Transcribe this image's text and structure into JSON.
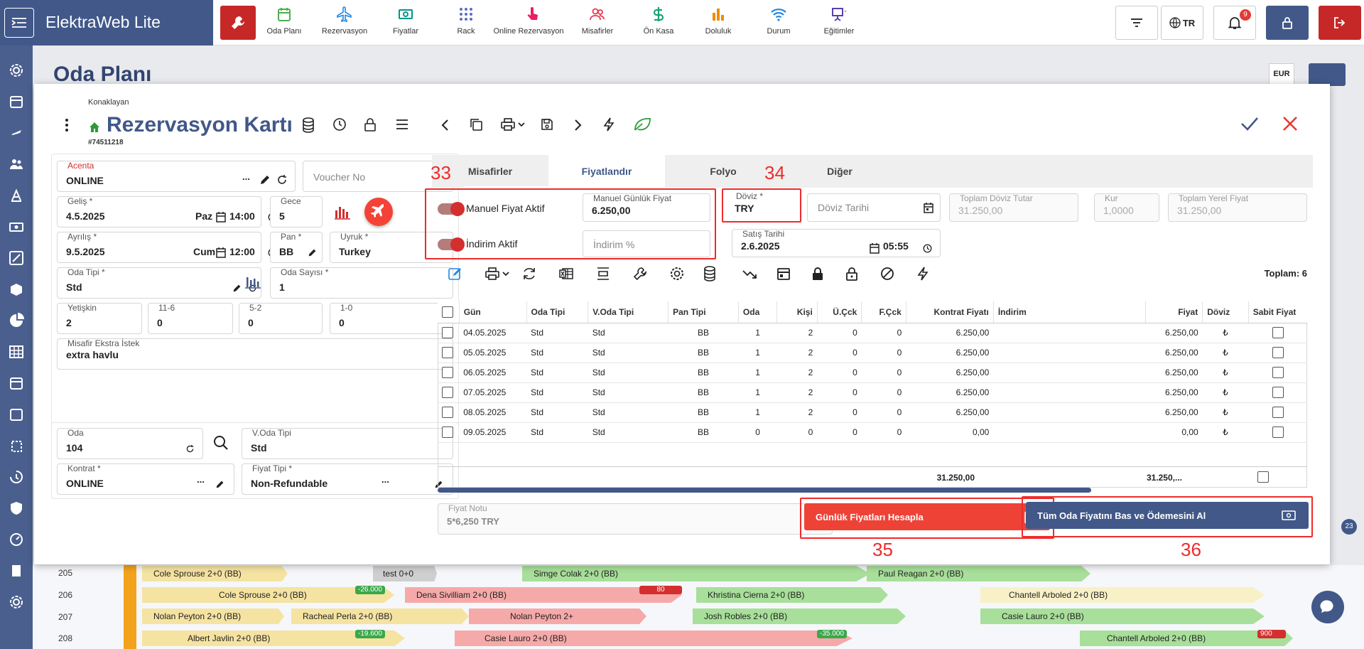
{
  "app": {
    "title": "ElektraWeb Lite"
  },
  "nav": [
    {
      "label": "Oda Planı",
      "icon": "calendar-icon"
    },
    {
      "label": "Rezervasyon",
      "icon": "plane-icon"
    },
    {
      "label": "Fiyatlar",
      "icon": "money-icon"
    },
    {
      "label": "Rack",
      "icon": "grid-dots-icon"
    },
    {
      "label": "Online Rezervasyon",
      "icon": "touch-icon"
    },
    {
      "label": "Misafirler",
      "icon": "users-icon"
    },
    {
      "label": "Ön Kasa",
      "icon": "dollar-icon"
    },
    {
      "label": "Doluluk",
      "icon": "bar-chart-icon"
    },
    {
      "label": "Durum",
      "icon": "wifi-icon"
    },
    {
      "label": "Eğitimler",
      "icon": "presentation-icon"
    }
  ],
  "topbar": {
    "language": "TR",
    "notifications": "9"
  },
  "background": {
    "page_title": "Oda Planı",
    "currency": "EUR",
    "rooms": [
      {
        "no": "205",
        "bookings": [
          "Cole Sprouse 2+0 (BB)",
          "test 0+0",
          "Simge Colak 2+0 (BB)",
          "Paul Reagan 2+0 (BB)"
        ]
      },
      {
        "no": "206",
        "bookings": [
          "Cole Sprouse 2+0 (BB)",
          "Dena Sivilliam 2+0 (BB)",
          "Khristina Cierna 2+0 (BB)",
          "Chantell Arboled 2+0 (BB)"
        ],
        "tags": [
          "-26.000",
          "80"
        ]
      },
      {
        "no": "207",
        "bookings": [
          "Nolan Peyton 2+0 (BB)",
          "Racheal Perla 2+0 (BB)",
          "Nolan Peyton 2+",
          "Josh Robles 2+0 (BB)",
          "Casie Lauro 2+0 (BB)"
        ]
      },
      {
        "no": "208",
        "bookings": [
          "Albert Javlin 2+0 (BB)",
          "Casie Lauro 2+0 (BB)",
          "Chantell Arboled 2+0 (BB)"
        ],
        "tags": [
          "-19.600",
          "-35.000",
          "900"
        ]
      }
    ],
    "side_badge": "23"
  },
  "modal": {
    "subtitle": "Konaklayan",
    "title": "Rezervasyon Kartı",
    "res_no": "#74511218",
    "tabs": [
      "Misafirler",
      "Fiyatlandır",
      "Folyo",
      "Diğer"
    ],
    "left": {
      "acenta_label": "Acenta",
      "acenta_value": "ONLINE",
      "voucher_placeholder": "Voucher No",
      "gelis_label": "Geliş *",
      "gelis_date": "4.5.2025",
      "gelis_day": "Paz",
      "gelis_time": "14:00",
      "gece_label": "Gece",
      "gece_value": "5",
      "ayrilis_label": "Ayrılış *",
      "ayrilis_date": "9.5.2025",
      "ayrilis_day": "Cum",
      "ayrilis_time": "12:00",
      "pan_label": "Pan *",
      "pan_value": "BB",
      "uyruk_label": "Uyruk *",
      "uyruk_value": "Turkey",
      "odatipi_label": "Oda Tipi *",
      "odatipi_value": "Std",
      "odasayisi_label": "Oda Sayısı *",
      "odasayisi_value": "1",
      "yetiskin_label": "Yetişkin",
      "yetiskin_value": "2",
      "c1_label": "11-6",
      "c1_value": "0",
      "c2_label": "5-2",
      "c2_value": "0",
      "c3_label": "1-0",
      "c3_value": "0",
      "ekstra_label": "Misafir Ekstra İstek",
      "ekstra_value": "extra havlu",
      "oda_label": "Oda",
      "oda_value": "104",
      "voda_label": "V.Oda Tipi",
      "voda_value": "Std",
      "kontrat_label": "Kontrat *",
      "kontrat_value": "ONLINE",
      "fiyattipi_label": "Fiyat Tipi *",
      "fiyattipi_value": "Non-Refundable"
    },
    "pricing": {
      "manuel_fiyat_label": "Manuel Fiyat Aktif",
      "indirim_aktif_label": "İndirim Aktif",
      "manuel_gunluk_label": "Manuel Günlük Fiyat",
      "manuel_gunluk_value": "6.250,00",
      "indirim_placeholder": "İndirim %",
      "doviz_label": "Döviz *",
      "doviz_value": "TRY",
      "doviz_tarihi_placeholder": "Döviz Tarihi",
      "toplam_doviz_label": "Toplam Döviz Tutar",
      "toplam_doviz_value": "31.250,00",
      "kur_label": "Kur",
      "kur_value": "1,0000",
      "toplam_yerel_label": "Toplam Yerel Fiyat",
      "toplam_yerel_value": "31.250,00",
      "satis_label": "Satış Tarihi",
      "satis_date": "2.6.2025",
      "satis_time": "05:55",
      "toplam_label": "Toplam: 6",
      "fiyat_notu_label": "Fiyat Notu",
      "fiyat_notu_value": "5*6,250 TRY",
      "btn_hesapla": "Günlük Fiyatları Hesapla",
      "btn_bas": "Tüm Oda Fiyatını Bas ve Ödemesini Al"
    },
    "grid": {
      "columns": [
        "Gün",
        "Oda Tipi",
        "V.Oda Tipi",
        "Pan Tipi",
        "Oda",
        "Kişi",
        "Ü.Çck",
        "F.Çck",
        "Kontrat Fiyatı",
        "İndirim",
        "Fiyat",
        "Döviz",
        "Sabit Fiyat"
      ],
      "rows": [
        [
          "04.05.2025",
          "Std",
          "Std",
          "BB",
          "1",
          "2",
          "0",
          "0",
          "6.250,00",
          "",
          "6.250,00",
          "₺"
        ],
        [
          "05.05.2025",
          "Std",
          "Std",
          "BB",
          "1",
          "2",
          "0",
          "0",
          "6.250,00",
          "",
          "6.250,00",
          "₺"
        ],
        [
          "06.05.2025",
          "Std",
          "Std",
          "BB",
          "1",
          "2",
          "0",
          "0",
          "6.250,00",
          "",
          "6.250,00",
          "₺"
        ],
        [
          "07.05.2025",
          "Std",
          "Std",
          "BB",
          "1",
          "2",
          "0",
          "0",
          "6.250,00",
          "",
          "6.250,00",
          "₺"
        ],
        [
          "08.05.2025",
          "Std",
          "Std",
          "BB",
          "1",
          "2",
          "0",
          "0",
          "6.250,00",
          "",
          "6.250,00",
          "₺"
        ],
        [
          "09.05.2025",
          "Std",
          "Std",
          "BB",
          "0",
          "0",
          "0",
          "0",
          "0,00",
          "",
          "0,00",
          "₺"
        ]
      ],
      "total_kontrat": "31.250,00",
      "total_fiyat": "31.250,..."
    },
    "annotations": [
      "33",
      "34",
      "35",
      "36"
    ]
  }
}
